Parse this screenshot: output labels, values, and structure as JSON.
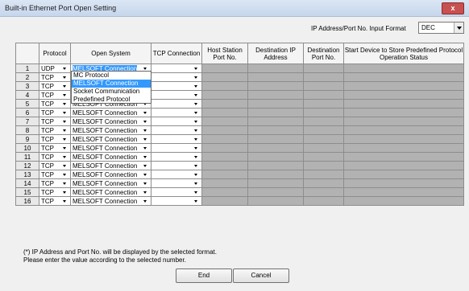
{
  "window": {
    "title": "Built-in Ethernet Port Open Setting",
    "close_label": "x"
  },
  "format": {
    "label": "IP Address/Port No. Input Format",
    "value": "DEC"
  },
  "table": {
    "headers": {
      "protocol": "Protocol",
      "open_system": "Open System",
      "tcp_connection": "TCP Connection",
      "host_port": "Host Station Port No.",
      "dest_ip": "Destination IP Address",
      "dest_port": "Destination Port No.",
      "start_device": "Start Device to Store Predefined Protocol Operation Status"
    },
    "rows": [
      {
        "no": "1",
        "protocol": "UDP",
        "open_system": "MELSOFT Connection"
      },
      {
        "no": "2",
        "protocol": "TCP",
        "open_system": "MELSOFT Connection"
      },
      {
        "no": "3",
        "protocol": "TCP",
        "open_system": "MELSOFT Connection"
      },
      {
        "no": "4",
        "protocol": "TCP",
        "open_system": "MELSOFT Connection"
      },
      {
        "no": "5",
        "protocol": "TCP",
        "open_system": "MELSOFT Connection"
      },
      {
        "no": "6",
        "protocol": "TCP",
        "open_system": "MELSOFT Connection"
      },
      {
        "no": "7",
        "protocol": "TCP",
        "open_system": "MELSOFT Connection"
      },
      {
        "no": "8",
        "protocol": "TCP",
        "open_system": "MELSOFT Connection"
      },
      {
        "no": "9",
        "protocol": "TCP",
        "open_system": "MELSOFT Connection"
      },
      {
        "no": "10",
        "protocol": "TCP",
        "open_system": "MELSOFT Connection"
      },
      {
        "no": "11",
        "protocol": "TCP",
        "open_system": "MELSOFT Connection"
      },
      {
        "no": "12",
        "protocol": "TCP",
        "open_system": "MELSOFT Connection"
      },
      {
        "no": "13",
        "protocol": "TCP",
        "open_system": "MELSOFT Connection"
      },
      {
        "no": "14",
        "protocol": "TCP",
        "open_system": "MELSOFT Connection"
      },
      {
        "no": "15",
        "protocol": "TCP",
        "open_system": "MELSOFT Connection"
      },
      {
        "no": "16",
        "protocol": "TCP",
        "open_system": "MELSOFT Connection"
      }
    ]
  },
  "dropdown": {
    "items": [
      "MC Protocol",
      "MELSOFT Connection",
      "Socket Communication",
      "Predefined Protocol"
    ],
    "selected": "MELSOFT Connection"
  },
  "note": {
    "line1": "(*) IP Address and Port No. will be displayed by the selected format.",
    "line2": "Please enter the value according to the selected number."
  },
  "buttons": {
    "end": "End",
    "cancel": "Cancel"
  },
  "colors": {
    "highlight": "#3399ff",
    "disabled_cell": "#b2b2b2"
  }
}
